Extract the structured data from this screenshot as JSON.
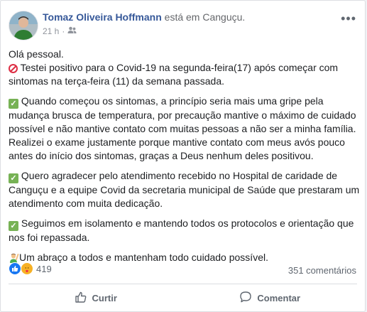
{
  "post": {
    "author_name": "Tomaz Oliveira Hoffmann",
    "location_text": " está em Canguçu.",
    "timestamp": "21 h",
    "separator": "·",
    "audience_icon": "friends-icon",
    "more_icon": "more-options-icon",
    "paragraphs": [
      {
        "lines": [
          {
            "emoji": "",
            "text": "Olá pessoal."
          },
          {
            "emoji": "no-entry",
            "text": " Testei positivo para o Covid-19 na segunda-feira(17) após começar com sintomas na terça-feira (11) da semana passada."
          }
        ]
      },
      {
        "lines": [
          {
            "emoji": "check",
            "text": " Quando começou os sintomas, a princípio seria mais uma gripe pela mudança brusca de temperatura, por precaução mantive o máximo de cuidado possível e não mantive contato com muitas pessoas a não ser a minha família. Realizei o exame justamente porque mantive contato com meus avós pouco antes do início dos sintomas, graças a Deus nenhum deles positivou."
          }
        ]
      },
      {
        "lines": [
          {
            "emoji": "check",
            "text": " Quero agradecer pelo atendimento recebido no Hospital de caridade de Canguçu e a equipe Covid da secretaria municipal de Saúde que prestaram um atendimento com muita dedicação."
          }
        ]
      },
      {
        "lines": [
          {
            "emoji": "check",
            "text": " Seguimos em isolamento e mantendo todos os protocolos e orientação que nos foi repassada."
          }
        ]
      },
      {
        "lines": [
          {
            "emoji": "person",
            "text": "Um abraço a todos e mantenham todo cuidado possível."
          }
        ]
      }
    ]
  },
  "stats": {
    "reaction_count": "419",
    "comments_text": "351 comentários",
    "reaction_icons": [
      "like-icon",
      "care-icon"
    ]
  },
  "actions": {
    "like_label": "Curtir",
    "comment_label": "Comentar"
  },
  "colors": {
    "link": "#365899",
    "text": "#1c1e21",
    "secondary": "#606770",
    "like_blue": "#1877f2"
  }
}
